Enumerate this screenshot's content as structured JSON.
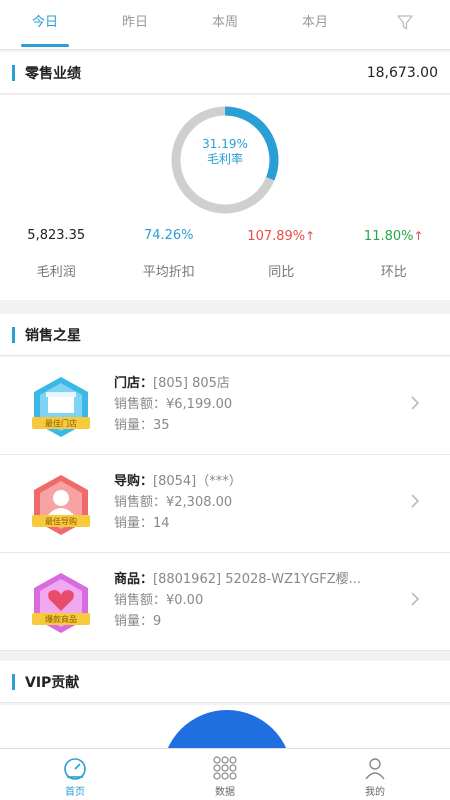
{
  "tabs": [
    "今日",
    "昨日",
    "本周",
    "本月"
  ],
  "filter_icon": "filter-icon",
  "retail": {
    "title": "零售业绩",
    "total": "18,673.00"
  },
  "margin_rate": {
    "percent_text": "31.19%",
    "label": "毛利率",
    "value": 31.19
  },
  "stats": [
    {
      "value": "5,823.35",
      "label": "毛利润",
      "color": "#222222"
    },
    {
      "value": "74.26%",
      "label": "平均折扣",
      "color": "#2a9fd6"
    },
    {
      "value": "107.89%",
      "label": "同比",
      "color": "#e94b4b",
      "arrow": "↑"
    },
    {
      "value": "11.80%",
      "label": "环比",
      "color": "#27a844",
      "arrow": "↑"
    }
  ],
  "sales_star": {
    "title": "销售之星",
    "items": [
      {
        "kind": "门店：",
        "name": "[805] 805店",
        "amount": "销售额：¥6,199.00",
        "qty": "销量：35",
        "badge": "最佳门店",
        "badge_color": "#3bb8e8"
      },
      {
        "kind": "导购：",
        "name": "[8054]（***）",
        "amount": "销售额：¥2,308.00",
        "qty": "销量：14",
        "badge": "最佳导购",
        "badge_color": "#ef6b6b"
      },
      {
        "kind": "商品：",
        "name": "[8801962] 52028-WZ1YGFZ樱...",
        "amount": "销售额：¥0.00",
        "qty": "销量：9",
        "badge": "爆款商品",
        "badge_color": "#d86be0"
      }
    ]
  },
  "vip": {
    "title": "VIP贡献"
  },
  "bottom_nav": [
    {
      "label": "首页",
      "icon": "dashboard-icon"
    },
    {
      "label": "数据",
      "icon": "grid-icon"
    },
    {
      "label": "我的",
      "icon": "user-icon"
    }
  ],
  "colors": {
    "accent": "#2a9fd6",
    "up": "#e94b4b",
    "green": "#27a844"
  }
}
